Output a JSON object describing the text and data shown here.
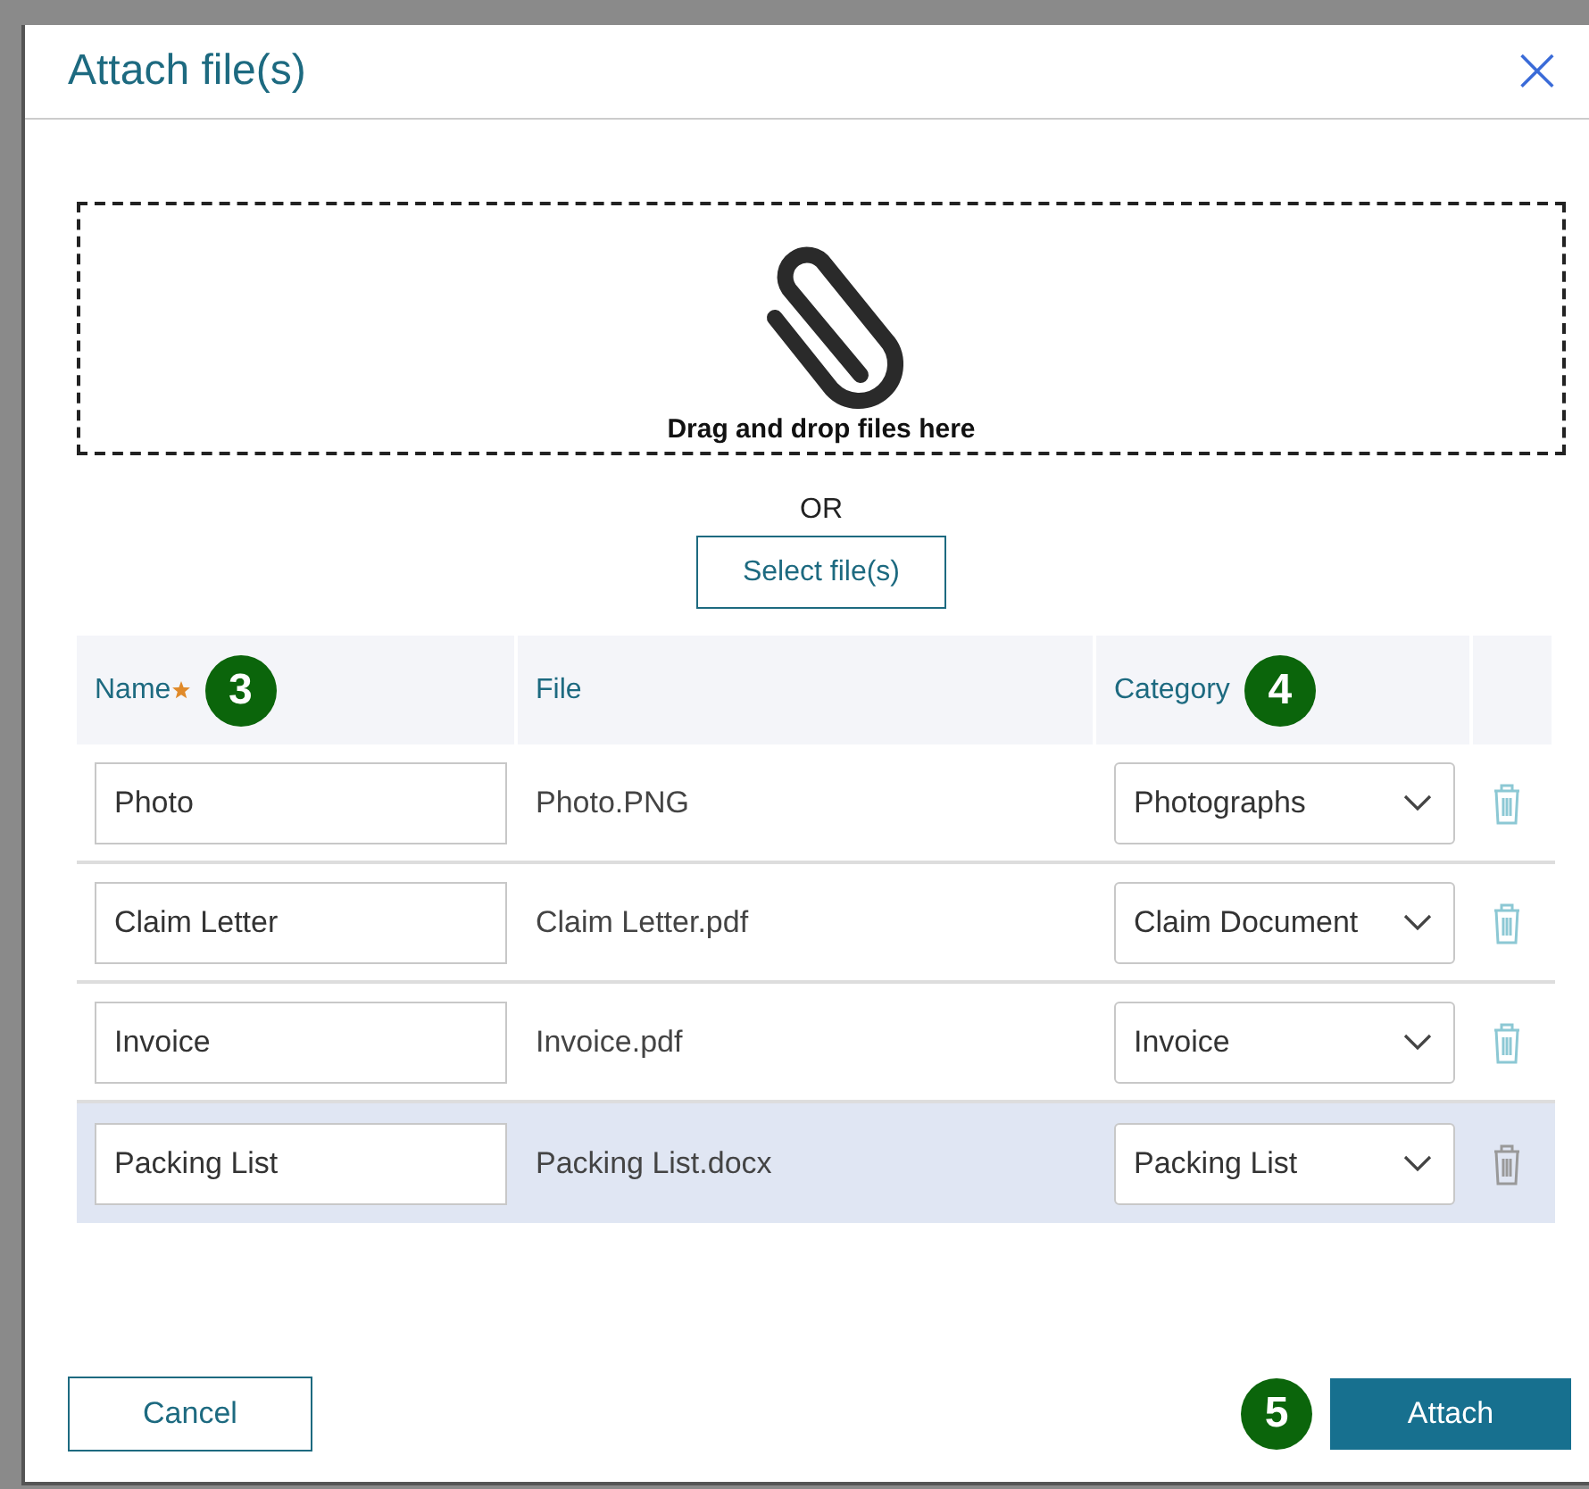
{
  "dialog": {
    "title": "Attach file(s)",
    "close": "×"
  },
  "dropzone": {
    "label": "Drag and drop files here"
  },
  "separator": "OR",
  "select_button": "Select file(s)",
  "table": {
    "columns": [
      {
        "label": "Name",
        "required": true,
        "callout": "3"
      },
      {
        "label": "File"
      },
      {
        "label": "Category",
        "callout": "4"
      },
      {}
    ],
    "rows": [
      {
        "name": "Photo",
        "file": "Photo.PNG",
        "category": "Photographs",
        "selected": false
      },
      {
        "name": "Claim Letter",
        "file": "Claim Letter.pdf",
        "category": "Claim Document",
        "selected": false
      },
      {
        "name": "Invoice",
        "file": "Invoice.pdf",
        "category": "Invoice",
        "selected": false
      },
      {
        "name": "Packing List",
        "file": "Packing List.docx",
        "category": "Packing List",
        "selected": true
      }
    ]
  },
  "footer": {
    "cancel": "Cancel",
    "attach": "Attach",
    "attach_callout": "5"
  }
}
